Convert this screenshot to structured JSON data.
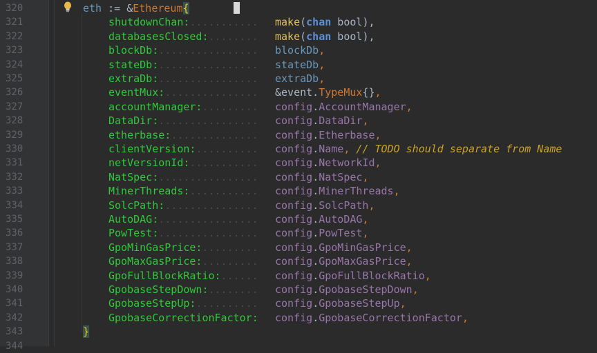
{
  "start_line": "320",
  "header": {
    "line": "320",
    "var": "eth",
    "op": " := &",
    "type": "Ethereum",
    "brace": "{"
  },
  "fields": [
    {
      "line": "321",
      "name": "shutdownChan:",
      "dots": "...........",
      "value": [
        [
          "fn",
          "make"
        ],
        [
          "plain",
          "("
        ],
        [
          "kwblue",
          "chan"
        ],
        [
          "plain",
          " bool"
        ],
        [
          "plain",
          "),"
        ]
      ]
    },
    {
      "line": "322",
      "name": "databasesClosed:",
      "dots": "........",
      "value": [
        [
          "fn",
          "make"
        ],
        [
          "plain",
          "("
        ],
        [
          "kwblue",
          "chan"
        ],
        [
          "plain",
          " bool"
        ],
        [
          "plain",
          "),"
        ]
      ]
    },
    {
      "line": "323",
      "name": "blockDb:",
      "dots": "................",
      "value": [
        [
          "var",
          "blockDb"
        ],
        [
          "punct",
          ","
        ]
      ]
    },
    {
      "line": "324",
      "name": "stateDb:",
      "dots": "................",
      "value": [
        [
          "var",
          "stateDb"
        ],
        [
          "punct",
          ","
        ]
      ]
    },
    {
      "line": "325",
      "name": "extraDb:",
      "dots": "................",
      "value": [
        [
          "var",
          "extraDb"
        ],
        [
          "punct",
          ","
        ]
      ]
    },
    {
      "line": "326",
      "name": "eventMux:",
      "dots": "...............",
      "value": [
        [
          "plain",
          "&event."
        ],
        [
          "kw",
          "TypeMux"
        ],
        [
          "plain",
          "{}"
        ],
        [
          "punct",
          ","
        ]
      ]
    },
    {
      "line": "327",
      "name": "accountManager:",
      "dots": ".........",
      "value": [
        [
          "cfg",
          "config"
        ],
        [
          "plain",
          "."
        ],
        [
          "member",
          "AccountManager"
        ],
        [
          "punct",
          ","
        ]
      ]
    },
    {
      "line": "328",
      "name": "DataDir:",
      "dots": "................",
      "value": [
        [
          "cfg",
          "config"
        ],
        [
          "plain",
          "."
        ],
        [
          "member",
          "DataDir"
        ],
        [
          "punct",
          ","
        ]
      ]
    },
    {
      "line": "329",
      "name": "etherbase:",
      "dots": "..............",
      "value": [
        [
          "cfg",
          "config"
        ],
        [
          "plain",
          "."
        ],
        [
          "member",
          "Etherbase"
        ],
        [
          "punct",
          ","
        ]
      ]
    },
    {
      "line": "330",
      "name": "clientVersion:",
      "dots": "..........",
      "value": [
        [
          "cfg",
          "config"
        ],
        [
          "plain",
          "."
        ],
        [
          "member",
          "Name"
        ],
        [
          "punct",
          ","
        ],
        [
          "plain",
          " "
        ],
        [
          "comment",
          "// TODO should separate from Name"
        ]
      ]
    },
    {
      "line": "331",
      "name": "netVersionId:",
      "dots": "...........",
      "value": [
        [
          "cfg",
          "config"
        ],
        [
          "plain",
          "."
        ],
        [
          "member",
          "NetworkId"
        ],
        [
          "punct",
          ","
        ]
      ]
    },
    {
      "line": "332",
      "name": "NatSpec:",
      "dots": "................",
      "value": [
        [
          "cfg",
          "config"
        ],
        [
          "plain",
          "."
        ],
        [
          "member",
          "NatSpec"
        ],
        [
          "punct",
          ","
        ]
      ]
    },
    {
      "line": "333",
      "name": "MinerThreads:",
      "dots": "...........",
      "value": [
        [
          "cfg",
          "config"
        ],
        [
          "plain",
          "."
        ],
        [
          "member",
          "MinerThreads"
        ],
        [
          "punct",
          ","
        ]
      ]
    },
    {
      "line": "334",
      "name": "SolcPath:",
      "dots": "...............",
      "value": [
        [
          "cfg",
          "config"
        ],
        [
          "plain",
          "."
        ],
        [
          "member",
          "SolcPath"
        ],
        [
          "punct",
          ","
        ]
      ]
    },
    {
      "line": "335",
      "name": "AutoDAG:",
      "dots": "................",
      "value": [
        [
          "cfg",
          "config"
        ],
        [
          "plain",
          "."
        ],
        [
          "member",
          "AutoDAG"
        ],
        [
          "punct",
          ","
        ]
      ]
    },
    {
      "line": "336",
      "name": "PowTest:",
      "dots": "................",
      "value": [
        [
          "cfg",
          "config"
        ],
        [
          "plain",
          "."
        ],
        [
          "member",
          "PowTest"
        ],
        [
          "punct",
          ","
        ]
      ]
    },
    {
      "line": "337",
      "name": "GpoMinGasPrice:",
      "dots": ".........",
      "value": [
        [
          "cfg",
          "config"
        ],
        [
          "plain",
          "."
        ],
        [
          "member",
          "GpoMinGasPrice"
        ],
        [
          "punct",
          ","
        ]
      ]
    },
    {
      "line": "338",
      "name": "GpoMaxGasPrice:",
      "dots": ".........",
      "value": [
        [
          "cfg",
          "config"
        ],
        [
          "plain",
          "."
        ],
        [
          "member",
          "GpoMaxGasPrice"
        ],
        [
          "punct",
          ","
        ]
      ]
    },
    {
      "line": "339",
      "name": "GpoFullBlockRatio:",
      "dots": "......",
      "value": [
        [
          "cfg",
          "config"
        ],
        [
          "plain",
          "."
        ],
        [
          "member",
          "GpoFullBlockRatio"
        ],
        [
          "punct",
          ","
        ]
      ]
    },
    {
      "line": "340",
      "name": "GpobaseStepDown:",
      "dots": "........",
      "value": [
        [
          "cfg",
          "config"
        ],
        [
          "plain",
          "."
        ],
        [
          "member",
          "GpobaseStepDown"
        ],
        [
          "punct",
          ","
        ]
      ]
    },
    {
      "line": "341",
      "name": "GpobaseStepUp:",
      "dots": "..........",
      "value": [
        [
          "cfg",
          "config"
        ],
        [
          "plain",
          "."
        ],
        [
          "member",
          "GpobaseStepUp"
        ],
        [
          "punct",
          ","
        ]
      ]
    },
    {
      "line": "342",
      "name": "GpobaseCorrectionFactor:",
      "dots": "",
      "value": [
        [
          "cfg",
          "config"
        ],
        [
          "plain",
          "."
        ],
        [
          "member",
          "GpobaseCorrectionFactor"
        ],
        [
          "punct",
          ","
        ]
      ]
    }
  ],
  "footer": {
    "line": "343",
    "brace": "}"
  },
  "trailing_line": "344",
  "icons": {
    "intention": "lightbulb-icon"
  },
  "colors": {
    "background": "#2b2b2b",
    "field": "#2fc93a",
    "keyword": "#cc7832",
    "config": "#9876aa",
    "comment": "#c9a227"
  }
}
